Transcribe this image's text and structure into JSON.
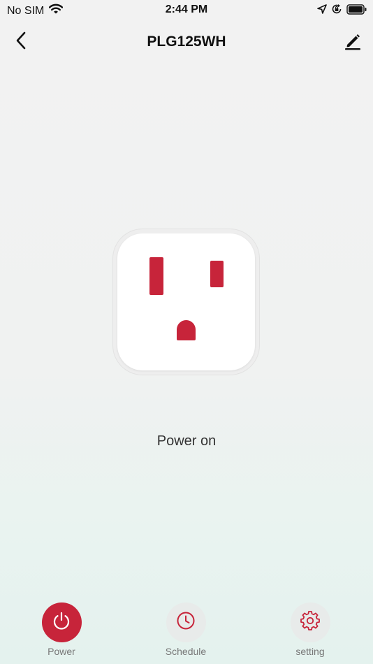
{
  "status_bar": {
    "carrier": "No SIM",
    "time": "2:44 PM",
    "icons": [
      "wifi-icon",
      "location-arrow-icon",
      "orientation-lock-icon",
      "battery-icon"
    ]
  },
  "nav": {
    "title": "PLG125WH",
    "back_icon": "chevron-left-icon",
    "edit_icon": "pencil-icon"
  },
  "outlet": {
    "state": "on",
    "slot_color": "#c7243a"
  },
  "status_text": "Power on",
  "tabs": [
    {
      "label": "Power",
      "icon": "power-icon",
      "active": true
    },
    {
      "label": "Schedule",
      "icon": "clock-icon",
      "active": false
    },
    {
      "label": "setting",
      "icon": "gear-icon",
      "active": false
    }
  ],
  "colors": {
    "accent": "#c7243a",
    "background": "#f2f2f2",
    "inactive_circle": "#e8ebea"
  }
}
